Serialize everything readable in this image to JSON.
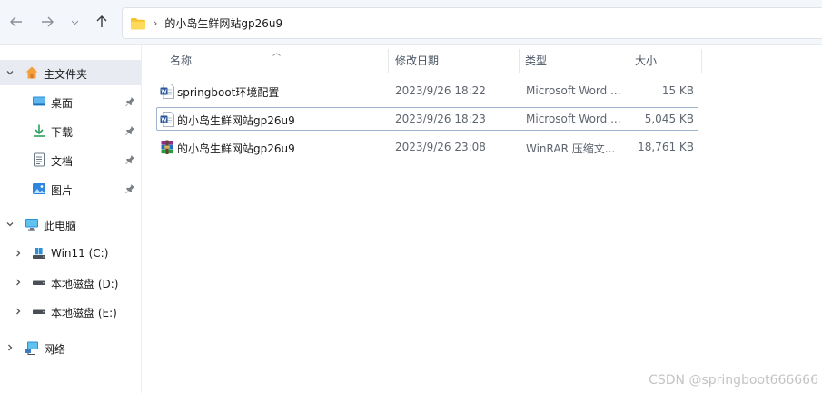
{
  "address": {
    "path": "的小岛生鲜网站gp26u9",
    "separator": "›"
  },
  "sidebar": {
    "home": {
      "label": "主文件夹"
    },
    "quick_access": [
      {
        "label": "桌面",
        "icon": "desktop-icon"
      },
      {
        "label": "下载",
        "icon": "download-icon"
      },
      {
        "label": "文档",
        "icon": "document-icon"
      },
      {
        "label": "图片",
        "icon": "pictures-icon"
      }
    ],
    "this_pc": {
      "label": "此电脑"
    },
    "drives": [
      {
        "label": "Win11 (C:)"
      },
      {
        "label": "本地磁盘 (D:)"
      },
      {
        "label": "本地磁盘 (E:)"
      }
    ],
    "network": {
      "label": "网络"
    }
  },
  "columns": {
    "name": "名称",
    "date": "修改日期",
    "type": "类型",
    "size": "大小"
  },
  "files": [
    {
      "name": "springboot环境配置",
      "date": "2023/9/26 18:22",
      "type": "Microsoft Word ...",
      "size": "15 KB",
      "icon": "word-file-icon"
    },
    {
      "name": "的小岛生鲜网站gp26u9",
      "date": "2023/9/26 18:23",
      "type": "Microsoft Word ...",
      "size": "5,045 KB",
      "icon": "word-file-icon"
    },
    {
      "name": "的小岛生鲜网站gp26u9",
      "date": "2023/9/26 23:08",
      "type": "WinRAR 压缩文...",
      "size": "18,761 KB",
      "icon": "winrar-archive-icon"
    }
  ],
  "watermark": "CSDN @springboot666666",
  "colors": {
    "folder": "#f4c430",
    "word_blue": "#2b579a",
    "focus_border": "#9fb4cc",
    "selected_bg": "#e8ecf2"
  }
}
